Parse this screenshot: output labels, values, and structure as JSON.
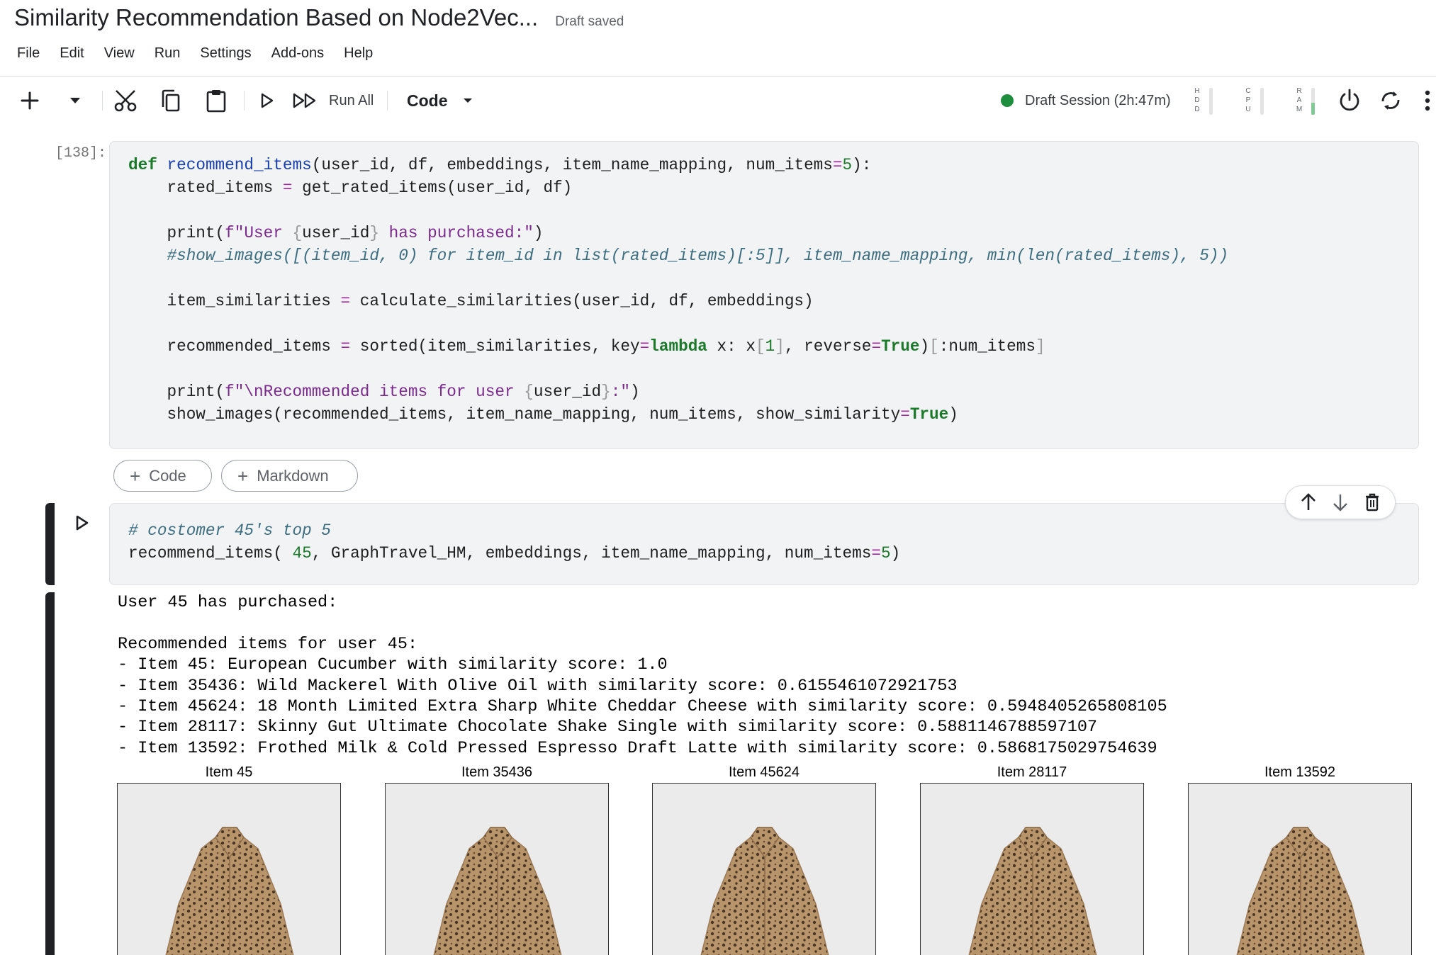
{
  "header": {
    "title": "Similarity Recommendation Based on Node2Vec...",
    "draft_status": "Draft saved"
  },
  "menu": [
    "File",
    "Edit",
    "View",
    "Run",
    "Settings",
    "Add-ons",
    "Help"
  ],
  "toolbar": {
    "run_all_label": "Run All",
    "cell_type": "Code",
    "session_label": "Draft Session (2h:47m)",
    "session_status_color": "#1e8e3e",
    "meters": [
      {
        "name": "HDD",
        "letters": "H D D",
        "level": 0.0
      },
      {
        "name": "CPU",
        "letters": "C P U",
        "level": 0.0
      },
      {
        "name": "RAM",
        "letters": "R A M",
        "level": 0.45
      }
    ],
    "icons": [
      "add-icon",
      "chevron-down-icon",
      "cut-icon",
      "copy-icon",
      "paste-icon",
      "run-icon",
      "run-all-icon",
      "power-icon",
      "restart-icon",
      "more-icon"
    ]
  },
  "cells": [
    {
      "prompt": "[138]:",
      "source": [
        "def recommend_items(user_id, df, embeddings, item_name_mapping, num_items=5):",
        "    rated_items = get_rated_items(user_id, df)",
        "",
        "    print(f\"User {user_id} has purchased:\")",
        "    #show_images([(item_id, 0) for item_id in list(rated_items)[:5]], item_name_mapping, min(len(rated_items), 5))",
        "",
        "    item_similarities = calculate_similarities(user_id, df, embeddings)",
        "",
        "    recommended_items = sorted(item_similarities, key=lambda x: x[1], reverse=True)[:num_items]",
        "",
        "    print(f\"\\nRecommended items for user {user_id}:\")",
        "    show_images(recommended_items, item_name_mapping, num_items, show_similarity=True)"
      ]
    },
    {
      "prompt": "",
      "source": [
        "# costomer 45's top 5",
        "recommend_items( 45, GraphTravel_HM, embeddings, item_name_mapping, num_items=5)"
      ]
    }
  ],
  "add_cell": {
    "code_label": "Code",
    "markdown_label": "Markdown"
  },
  "cell_actions": [
    "arrow-up-icon",
    "arrow-down-icon",
    "delete-icon"
  ],
  "output": {
    "lines": [
      "User 45 has purchased:",
      "",
      "Recommended items for user 45:",
      "- Item 45: European Cucumber with similarity score: 1.0",
      "- Item 35436: Wild Mackerel With Olive Oil with similarity score: 0.6155461072921753",
      "- Item 45624: 18 Month Limited Extra Sharp White Cheddar Cheese with similarity score: 0.5948405265808105",
      "- Item 28117: Skinny Gut Ultimate Chocolate Shake Single with similarity score: 0.5881146788597107",
      "- Item 13592: Frothed Milk & Cold Pressed Espresso Draft Latte with similarity score: 0.5868175029754639"
    ],
    "images": [
      {
        "title": "Item 45"
      },
      {
        "title": "Item 35436"
      },
      {
        "title": "Item 45624"
      },
      {
        "title": "Item 28117"
      },
      {
        "title": "Item 13592"
      }
    ]
  }
}
